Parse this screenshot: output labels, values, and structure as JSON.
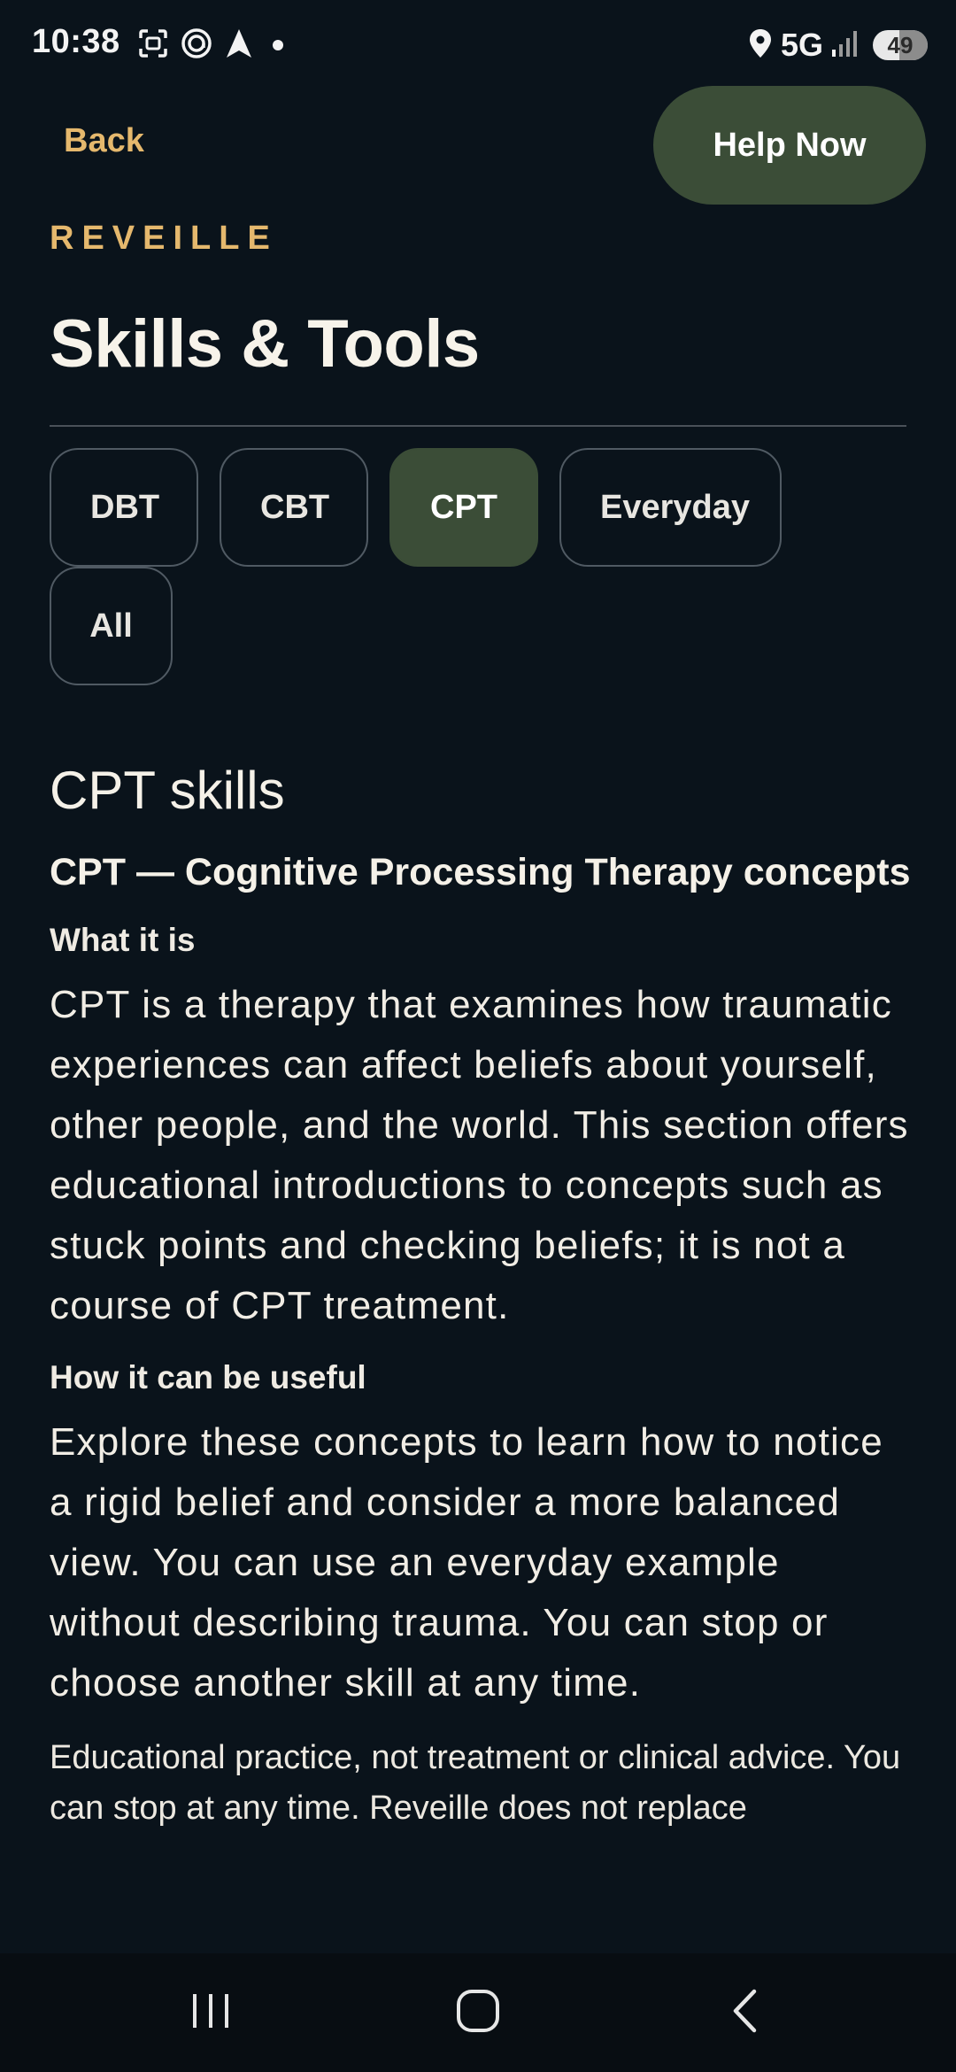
{
  "status_bar": {
    "time": "10:38",
    "left_icons": [
      "screenshot-icon",
      "at-sign-icon",
      "navigation-arrow-icon",
      "dot-icon"
    ],
    "right_icons": [
      "location-pin-icon",
      "signal-icon"
    ],
    "network": "5G",
    "battery_percent": "49",
    "battery_level": 0.49
  },
  "header": {
    "back_label": "Back",
    "help_label": "Help Now",
    "brand": "REVEILLE",
    "title": "Skills & Tools"
  },
  "filters": {
    "active": "CPT",
    "chips": [
      {
        "label": "DBT"
      },
      {
        "label": "CBT"
      },
      {
        "label": "CPT"
      },
      {
        "label": "Everyday"
      },
      {
        "label": "All"
      }
    ]
  },
  "content": {
    "section_title": "CPT skills",
    "skill_title": "CPT — Cognitive Processing Therapy concepts",
    "what_heading": "What it is",
    "what_body": "CPT is a therapy that examines how traumatic experiences can affect beliefs about yourself, other people, and the world. This section offers educational introductions to concepts such as stuck points and checking beliefs; it is not a course of CPT treatment.",
    "useful_heading": "How it can be useful",
    "useful_body": "Explore these concepts to learn how to notice a rigid belief and consider a more balanced view. You can use an everyday example without describing trauma. You can stop or choose another skill at any time.",
    "disclaimer": "Educational practice, not treatment or clinical advice. You can stop at any time. Reveille does not replace"
  },
  "nav": {
    "buttons": [
      "recent-apps-icon",
      "home-icon",
      "back-icon"
    ]
  },
  "colors": {
    "background": "#0a131b",
    "accent_gold": "#e5b86d",
    "accent_green": "#3b4d37",
    "chip_border": "#505a63"
  }
}
